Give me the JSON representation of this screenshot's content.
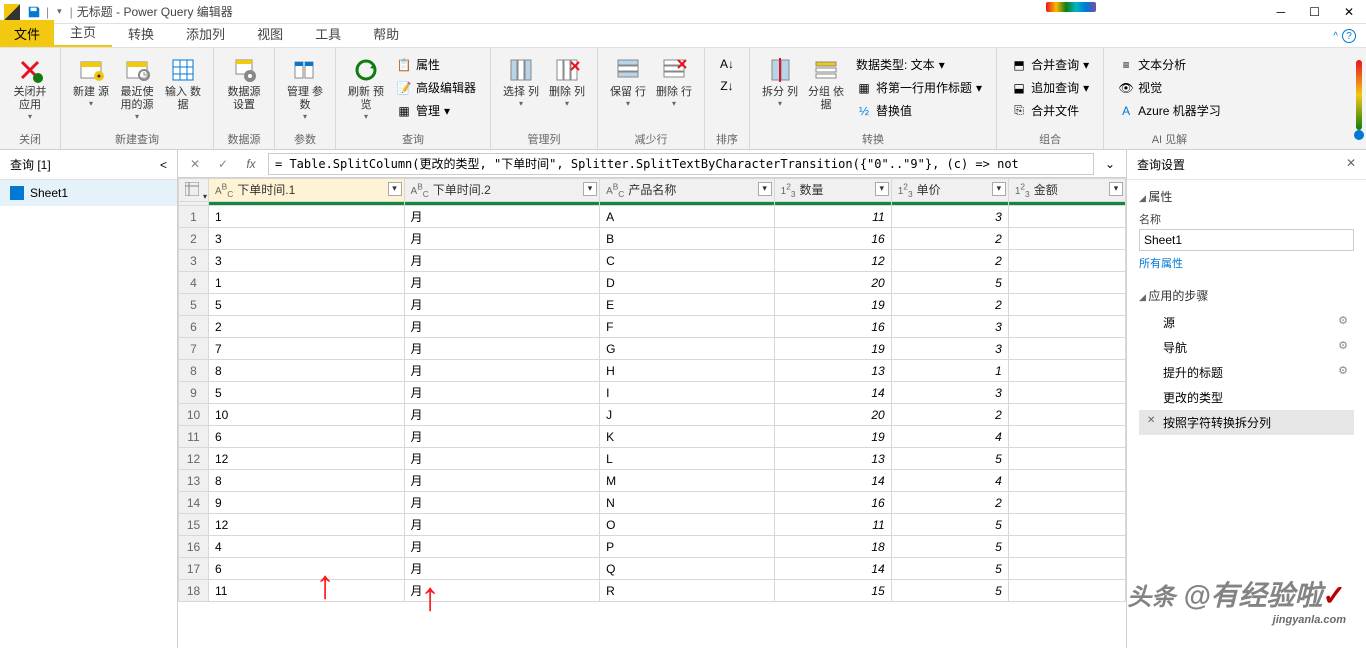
{
  "window": {
    "title": "无标题 - Power Query 编辑器"
  },
  "ribbon_tabs": {
    "file": "文件",
    "tabs": [
      "主页",
      "转换",
      "添加列",
      "视图",
      "工具",
      "帮助"
    ],
    "active_index": 0
  },
  "ribbon_groups": {
    "close": {
      "label": "关闭",
      "btn1": "关闭并\n应用"
    },
    "new_query": {
      "label": "新建查询",
      "btn1": "新建\n源",
      "btn2": "最近使\n用的源",
      "btn3": "输入\n数据"
    },
    "datasource": {
      "label": "数据源",
      "btn1": "数据源\n设置"
    },
    "params": {
      "label": "参数",
      "btn1": "管理\n参数"
    },
    "query": {
      "label": "查询",
      "btn1": "刷新\n预览",
      "item1": "属性",
      "item2": "高级编辑器",
      "item3": "管理"
    },
    "manage_cols": {
      "label": "管理列",
      "btn1": "选择\n列",
      "btn2": "删除\n列"
    },
    "reduce_rows": {
      "label": "减少行",
      "btn1": "保留\n行",
      "btn2": "删除\n行"
    },
    "sort": {
      "label": "排序"
    },
    "transform": {
      "label": "转换",
      "btn1": "拆分\n列",
      "btn2": "分组\n依据",
      "item1": "数据类型: 文本",
      "item2": "将第一行用作标题",
      "item3": "替换值"
    },
    "combine": {
      "label": "组合",
      "item1": "合并查询",
      "item2": "追加查询",
      "item3": "合并文件"
    },
    "ai": {
      "label": "AI 见解",
      "item1": "文本分析",
      "item2": "视觉",
      "item3": "Azure 机器学习"
    }
  },
  "queries_panel": {
    "header": "查询 [1]",
    "items": [
      "Sheet1"
    ]
  },
  "formula": "= Table.SplitColumn(更改的类型, \"下单时间\", Splitter.SplitTextByCharacterTransition({\"0\"..\"9\"}, (c) => not",
  "columns": [
    {
      "name": "下单时间.1",
      "type": "ABC",
      "selected": true
    },
    {
      "name": "下单时间.2",
      "type": "ABC",
      "selected": false
    },
    {
      "name": "产品名称",
      "type": "ABC",
      "selected": false
    },
    {
      "name": "数量",
      "type": "123",
      "selected": false
    },
    {
      "name": "单价",
      "type": "123",
      "selected": false
    },
    {
      "name": "金额",
      "type": "123",
      "selected": false
    }
  ],
  "rows": [
    [
      "1",
      "月",
      "A",
      "11",
      "3",
      ""
    ],
    [
      "3",
      "月",
      "B",
      "16",
      "2",
      ""
    ],
    [
      "3",
      "月",
      "C",
      "12",
      "2",
      ""
    ],
    [
      "1",
      "月",
      "D",
      "20",
      "5",
      ""
    ],
    [
      "5",
      "月",
      "E",
      "19",
      "2",
      ""
    ],
    [
      "2",
      "月",
      "F",
      "16",
      "3",
      ""
    ],
    [
      "7",
      "月",
      "G",
      "19",
      "3",
      ""
    ],
    [
      "8",
      "月",
      "H",
      "13",
      "1",
      ""
    ],
    [
      "5",
      "月",
      "I",
      "14",
      "3",
      ""
    ],
    [
      "10",
      "月",
      "J",
      "20",
      "2",
      ""
    ],
    [
      "6",
      "月",
      "K",
      "19",
      "4",
      ""
    ],
    [
      "12",
      "月",
      "L",
      "13",
      "5",
      ""
    ],
    [
      "8",
      "月",
      "M",
      "14",
      "4",
      ""
    ],
    [
      "9",
      "月",
      "N",
      "16",
      "2",
      ""
    ],
    [
      "12",
      "月",
      "O",
      "11",
      "5",
      ""
    ],
    [
      "4",
      "月",
      "P",
      "18",
      "5",
      ""
    ],
    [
      "6",
      "月",
      "Q",
      "14",
      "5",
      ""
    ],
    [
      "11",
      "月",
      "R",
      "15",
      "5",
      ""
    ]
  ],
  "settings": {
    "title": "查询设置",
    "props_title": "属性",
    "name_label": "名称",
    "name_value": "Sheet1",
    "all_props": "所有属性",
    "steps_title": "应用的步骤",
    "steps": [
      {
        "label": "源",
        "gear": true
      },
      {
        "label": "导航",
        "gear": true
      },
      {
        "label": "提升的标题",
        "gear": true
      },
      {
        "label": "更改的类型",
        "gear": false
      },
      {
        "label": "按照字符转换拆分列",
        "gear": false,
        "x": true,
        "active": true
      }
    ]
  },
  "watermark": {
    "prefix": "头条",
    "at": "@",
    "main": "有经验啦",
    "sub": "jingyanla.com"
  }
}
